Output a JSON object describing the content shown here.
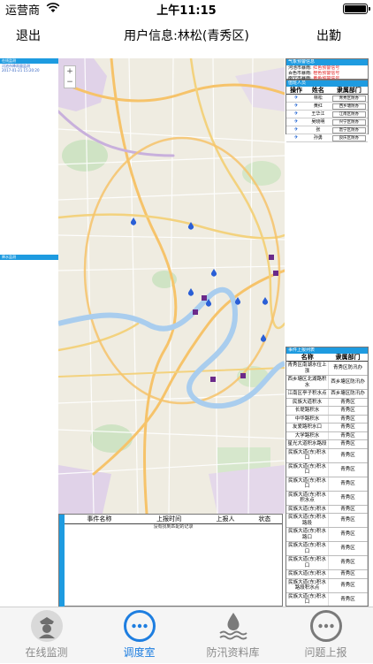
{
  "status_bar": {
    "carrier": "运营商",
    "time": "上午11:15"
  },
  "nav": {
    "back_label": "退出",
    "title": "用户信息:林松(青秀区)",
    "right_label": "出勤"
  },
  "left_panels": {
    "top": {
      "header": "在线监测",
      "line1": "河池市降雨量监测",
      "line2": "2017-01-21 15:20:20"
    },
    "middle": {
      "header": "降水监测"
    }
  },
  "map": {
    "zoom_in": "+",
    "zoom_out": "−"
  },
  "right_panels": {
    "weather": {
      "header": "气象预警信息",
      "lines": [
        {
          "label": "河池市暴雨: ",
          "value": "红色预警信号"
        },
        {
          "label": "百色市暴雨: ",
          "value": "橙色预警信号"
        },
        {
          "label": "南宁市暴雨: ",
          "value": "黄色预警信号"
        }
      ]
    },
    "staff": {
      "header": "值班人员",
      "columns": [
        "操作",
        "姓名",
        "隶属部门"
      ],
      "rows": [
        {
          "name": "林松",
          "dept": "青秀区防办"
        },
        {
          "name": "黄红",
          "dept": "西乡塘防办"
        },
        {
          "name": "王华江",
          "dept": "江南区防办"
        },
        {
          "name": "吴晓明",
          "dept": "兴宁区防办"
        },
        {
          "name": "张",
          "dept": "邕宁区防办"
        },
        {
          "name": "孙勇",
          "dept": "良庆区防办"
        }
      ]
    },
    "events": {
      "header": "事件上报列表",
      "columns": [
        "名称",
        "隶属部门"
      ],
      "rows": [
        {
          "name": "青秀区南湖水位上涨",
          "dept": "青秀区防汛办"
        },
        {
          "name": "西乡塘区北湖路积水",
          "dept": "西乡塘区防汛办"
        },
        {
          "name": "江南区亭子积水点",
          "dept": "西乡塘区防汛办"
        },
        {
          "name": "民族大道积水",
          "dept": "青秀区"
        },
        {
          "name": "长堤路积水",
          "dept": "青秀区"
        },
        {
          "name": "中华路积水",
          "dept": "青秀区"
        },
        {
          "name": "友爱路积水口",
          "dept": "青秀区"
        },
        {
          "name": "大学路积水",
          "dept": "青秀区"
        },
        {
          "name": "星光大道积水路段",
          "dept": "青秀区"
        },
        {
          "name": "民族大道(东)积水口",
          "dept": "青秀区"
        },
        {
          "name": "民族大道(东)积水口",
          "dept": "青秀区"
        },
        {
          "name": "民族大道(东)积水口",
          "dept": "青秀区"
        },
        {
          "name": "民族大道(东)积水积水点",
          "dept": "青秀区"
        },
        {
          "name": "民族大道(东)积水",
          "dept": "青秀区"
        },
        {
          "name": "民族大道(东)积水路段",
          "dept": "青秀区"
        },
        {
          "name": "民族大道(东)积水路口",
          "dept": "青秀区"
        },
        {
          "name": "民族大道(东)积水口",
          "dept": "青秀区"
        },
        {
          "name": "民族大道(东)积水口",
          "dept": "青秀区"
        },
        {
          "name": "民族大道(东)积水",
          "dept": "青秀区"
        },
        {
          "name": "民族大道(东)积水路段积水点",
          "dept": "青秀区"
        },
        {
          "name": "民族大道(东)积水口",
          "dept": "青秀区"
        },
        {
          "name": "民族大道(东)积水",
          "dept": "青秀区"
        },
        {
          "name": "民族大道(东)积水",
          "dept": "青秀区"
        }
      ]
    }
  },
  "report_list": {
    "side_label": "事件上报",
    "columns": [
      "事件名称",
      "上报时间",
      "上报人",
      "状态"
    ],
    "empty_text": "没有找到匹配的记录"
  },
  "tabs": [
    {
      "label": "在线监测",
      "icon": "police-badge-icon",
      "active": false
    },
    {
      "label": "调度室",
      "icon": "more-circle-icon",
      "active": true
    },
    {
      "label": "防汛资料库",
      "icon": "water-drop-icon",
      "active": false
    },
    {
      "label": "问题上报",
      "icon": "more-circle-icon",
      "active": false
    }
  ],
  "colors": {
    "accent": "#1e7ee0",
    "panel_header": "#1e9be0",
    "warning": "#e02020"
  }
}
